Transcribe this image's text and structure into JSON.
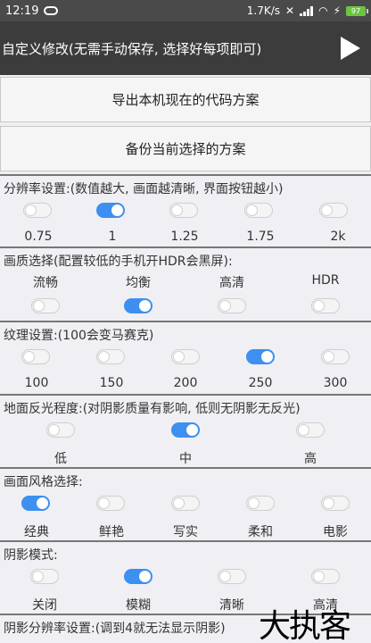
{
  "status_bar": {
    "time": "12:19",
    "network_speed": "1.7K/s",
    "battery": "97"
  },
  "header": {
    "title": "自定义修改(无需手动保存, 选择好每项即可)"
  },
  "buttons": {
    "export": "导出本机现在的代码方案",
    "backup": "备份当前选择的方案"
  },
  "sections": {
    "resolution": {
      "title": "分辨率设置:(数值越大, 画面越清晰, 界面按钮越小)",
      "options": [
        "0.75",
        "1",
        "1.25",
        "1.75",
        "2k"
      ],
      "selected": 1
    },
    "quality": {
      "title": "画质选择(配置较低的手机开HDR会黑屏):",
      "options": [
        "流畅",
        "均衡",
        "高清",
        "HDR"
      ],
      "selected": 1
    },
    "texture": {
      "title": "纹理设置:(100会变马赛克)",
      "options": [
        "100",
        "150",
        "200",
        "250",
        "300"
      ],
      "selected": 3
    },
    "reflection": {
      "title": "地面反光程度:(对阴影质量有影响, 低则无阴影无反光)",
      "options": [
        "低",
        "中",
        "高"
      ],
      "selected": 1
    },
    "style": {
      "title": "画面风格选择:",
      "options": [
        "经典",
        "鲜艳",
        "写实",
        "柔和",
        "电影"
      ],
      "selected": 0
    },
    "shadow": {
      "title": "阴影模式:",
      "options": [
        "关闭",
        "模糊",
        "清晰",
        "高清"
      ],
      "selected": 1
    },
    "shadow_res": {
      "title": "阴影分辨率设置:(调到4就无法显示阴影)"
    }
  },
  "watermark": "大执客"
}
